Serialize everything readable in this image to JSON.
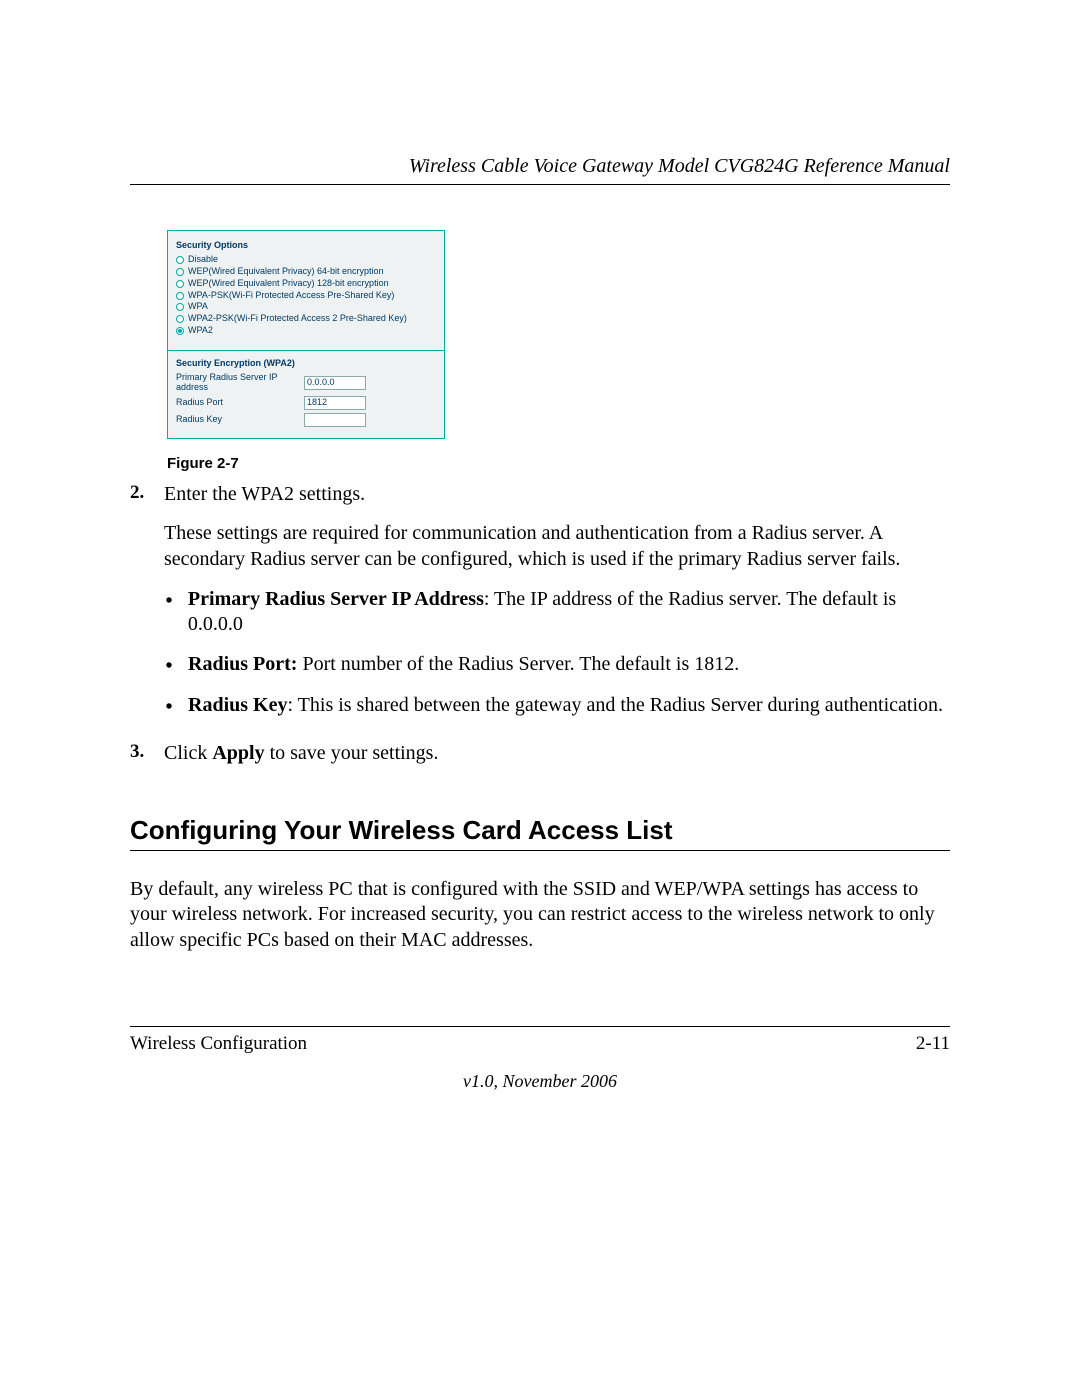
{
  "header": {
    "title": "Wireless Cable Voice Gateway Model CVG824G Reference Manual"
  },
  "panel": {
    "section1_title": "Security Options",
    "options": [
      {
        "label": "Disable",
        "selected": false
      },
      {
        "label": "WEP(Wired Equivalent Privacy) 64-bit encryption",
        "selected": false
      },
      {
        "label": "WEP(Wired Equivalent Privacy) 128-bit encryption",
        "selected": false
      },
      {
        "label": "WPA-PSK(Wi-Fi Protected Access Pre-Shared Key)",
        "selected": false
      },
      {
        "label": "WPA",
        "selected": false
      },
      {
        "label": "WPA2-PSK(Wi-Fi Protected Access 2 Pre-Shared Key)",
        "selected": false
      },
      {
        "label": "WPA2",
        "selected": true
      }
    ],
    "section2_title": "Security Encryption (WPA2)",
    "rows": [
      {
        "k": "Primary Radius Server IP address",
        "v": "0.0.0.0"
      },
      {
        "k": "Radius Port",
        "v": "1812"
      },
      {
        "k": "Radius Key",
        "v": ""
      }
    ]
  },
  "figure_caption": "Figure 2-7",
  "step2": {
    "num": "2.",
    "line1": "Enter the WPA2 settings.",
    "line2": "These settings are required for communication and authentication from a Radius server. A secondary Radius server can be configured, which is used if the primary Radius server fails.",
    "b1_bold": "Primary Radius Server IP Address",
    "b1_rest": ": The IP address of the Radius server. The default is 0.0.0.0",
    "b2_bold": "Radius Port:",
    "b2_rest": " Port number of the Radius Server. The default is 1812.",
    "b3_bold": "Radius Key",
    "b3_rest": ": This is shared between the gateway and the Radius Server during authentication."
  },
  "step3": {
    "num": "3.",
    "pre": "Click ",
    "bold": "Apply",
    "post": " to save your settings."
  },
  "h2": "Configuring Your Wireless Card Access List",
  "para": "By default, any wireless PC that is configured with the SSID and WEP/WPA settings has access to your wireless network. For increased security, you can restrict access to the wireless network to only allow specific PCs based on their MAC addresses.",
  "footer": {
    "left": "Wireless Configuration",
    "right": "2-11",
    "version": "v1.0, November 2006"
  },
  "glyphs": {
    "bullet": "•"
  }
}
